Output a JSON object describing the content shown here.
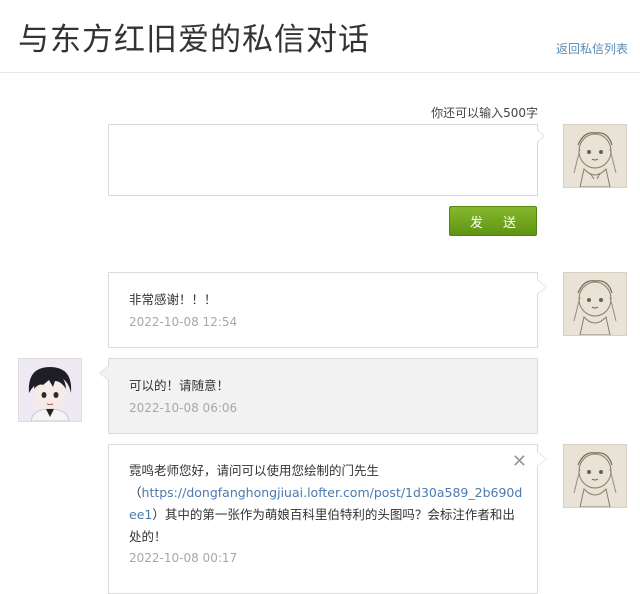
{
  "header": {
    "title": "与东方红旧爱的私信对话",
    "back_link": "返回私信列表"
  },
  "compose": {
    "char_hint": "你还可以输入500字",
    "send_label": "发 送",
    "input_value": ""
  },
  "messages": [
    {
      "from": "me",
      "text": "非常感谢！！！",
      "time": "2022-10-08 12:54"
    },
    {
      "from": "other",
      "text": "可以的！请随意！",
      "time": "2022-10-08 06:06"
    },
    {
      "from": "me",
      "text_parts": {
        "line1": "霓鸣老师您好，请问可以使用您绘制的门先生",
        "paren_open": "（",
        "link": "https://dongfanghongjiuai.lofter.com/post/1d30a589_2b690dee1",
        "after_link": "）其中的第一张作为萌娘百科里伯特利的头图吗？会标注作者和出处的！"
      },
      "time": "2022-10-08 00:17",
      "close_icon": "close-icon"
    }
  ],
  "colors": {
    "send_button": "#6fa31e",
    "link": "#4a7ab0",
    "timestamp": "#a8a8a8"
  }
}
